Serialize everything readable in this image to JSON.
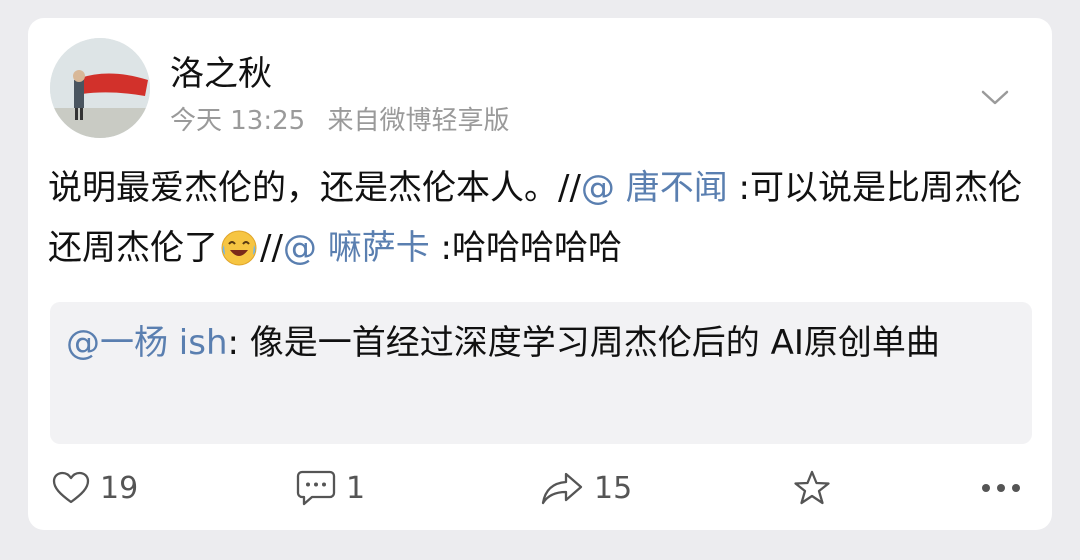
{
  "post": {
    "username": "洛之秋",
    "time": "今天 13:25",
    "source": "来自微博轻享版",
    "text_part1": "说明最爱杰伦的，还是杰伦本人。//",
    "mention1": "@ 唐不闻",
    "text_part2": " :可以说是比周杰伦还周杰伦了",
    "emoji": "laughing-tears-emoji",
    "text_part3": "//",
    "mention2": "@ 嘛萨卡",
    "text_part4": " :哈哈哈哈哈"
  },
  "quote": {
    "mention": "@一杨 ish",
    "text": ": 像是一首经过深度学习周杰伦后的 AI原创单曲"
  },
  "actions": {
    "likes": "19",
    "comments": "1",
    "reposts": "15"
  },
  "icons": {
    "like": "heart-icon",
    "comment": "comment-icon",
    "repost": "share-arrow-icon",
    "favorite": "star-icon",
    "more": "more-dots-icon",
    "menu": "chevron-down-icon"
  },
  "colors": {
    "mention": "#5a7fb0",
    "meta": "#9a9a9a",
    "background": "#ececef",
    "quote_background": "#f2f2f4"
  }
}
